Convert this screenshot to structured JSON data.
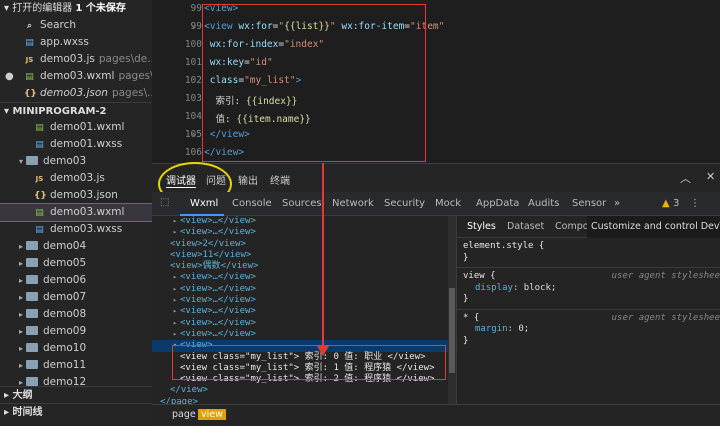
{
  "sidebar": {
    "open_editors_title": "打开的编辑器",
    "unsaved_badge": "1 个未保存",
    "open_editors": [
      {
        "icon": "search-icon",
        "label": "Search",
        "hint": ""
      },
      {
        "icon": "css-file-icon",
        "label": "app.wxss",
        "hint": ""
      },
      {
        "icon": "js-file-icon",
        "label": "demo03.js",
        "hint": "pages\\de..."
      },
      {
        "icon": "xml-file-icon",
        "label": "demo03.wxml",
        "hint": "pages\\..."
      },
      {
        "icon": "json-file-icon",
        "label": "demo03.json",
        "hint": "pages\\..."
      }
    ],
    "project_title": "MINIPROGRAM-2",
    "tree": [
      {
        "icon": "xml-file-icon",
        "label": "demo01.wxml",
        "indent": 2
      },
      {
        "icon": "css-file-icon",
        "label": "demo01.wxss",
        "indent": 2
      },
      {
        "icon": "folder-icon",
        "label": "demo03",
        "indent": 1,
        "arrow": "▾"
      },
      {
        "icon": "js-file-icon",
        "label": "demo03.js",
        "indent": 2
      },
      {
        "icon": "json-file-icon",
        "label": "demo03.json",
        "indent": 2
      },
      {
        "icon": "xml-file-icon",
        "label": "demo03.wxml",
        "indent": 2,
        "selected": true
      },
      {
        "icon": "css-file-icon",
        "label": "demo03.wxss",
        "indent": 2
      },
      {
        "icon": "folder-icon",
        "label": "demo04",
        "indent": 1,
        "arrow": "▸"
      },
      {
        "icon": "folder-icon",
        "label": "demo05",
        "indent": 1,
        "arrow": "▸"
      },
      {
        "icon": "folder-icon",
        "label": "demo06",
        "indent": 1,
        "arrow": "▸"
      },
      {
        "icon": "folder-icon",
        "label": "demo07",
        "indent": 1,
        "arrow": "▸"
      },
      {
        "icon": "folder-icon",
        "label": "demo08",
        "indent": 1,
        "arrow": "▸"
      },
      {
        "icon": "folder-icon",
        "label": "demo09",
        "indent": 1,
        "arrow": "▸"
      },
      {
        "icon": "folder-icon",
        "label": "demo10",
        "indent": 1,
        "arrow": "▸"
      },
      {
        "icon": "folder-icon",
        "label": "demo11",
        "indent": 1,
        "arrow": "▸"
      },
      {
        "icon": "folder-icon",
        "label": "demo12",
        "indent": 1,
        "arrow": "▸"
      }
    ],
    "outline_title": "大纲",
    "timeline_title": "时间线"
  },
  "editor": {
    "lines": [
      {
        "num": "99",
        "html": "<span class='tag'>&lt;view&gt;</span>"
      },
      {
        "num": "99",
        "html": "<span class='tag'>&lt;view</span> <span class='attr'>wx:for</span>=<span class='str'>\"<span class='brace'>{{list}}</span>\"</span> <span class='attr'>wx:for-item</span>=<span class='str'>\"item\"</span>"
      },
      {
        "num": "100",
        "html": "&nbsp;<span class='attr'>wx:for-index</span>=<span class='str'>\"index\"</span>"
      },
      {
        "num": "101",
        "html": "&nbsp;<span class='attr'>wx:key</span>=<span class='str'>\"id\"</span>"
      },
      {
        "num": "102",
        "html": "&nbsp;<span class='attr'>class</span>=<span class='str'>\"my_list\"</span><span class='tag'>&gt;</span>"
      },
      {
        "num": "103",
        "html": "&nbsp;&nbsp;<span class='cn'>索引: </span><span class='brace'>{{index}}</span>"
      },
      {
        "num": "104",
        "html": "&nbsp;&nbsp;<span class='cn'>值: </span><span class='brace'>{{item.name}}</span>"
      },
      {
        "num": "105",
        "html": "&nbsp;<span class='tag'>&lt;/view&gt;</span>"
      },
      {
        "num": "106",
        "html": "<span class='tag'>&lt;/view&gt;</span>"
      }
    ]
  },
  "debugger": {
    "tabs": [
      "调试器",
      "问题",
      "输出",
      "终端"
    ],
    "panel_tabs": [
      "Wxml",
      "Console",
      "Sources",
      "Network",
      "Security",
      "Mock",
      "AppData",
      "Audits",
      "Sensor"
    ],
    "more": "»",
    "warnings": "3",
    "dom_lines": [
      {
        "tri": "▸",
        "text": "<view>…</view>",
        "indent": 0
      },
      {
        "tri": "▸",
        "text": "<view>…</view>",
        "indent": 0
      },
      {
        "tri": "",
        "text": "<view>2</view>",
        "indent": 0
      },
      {
        "tri": "",
        "text": "<view>11</view>",
        "indent": 0
      },
      {
        "tri": "",
        "text": "<view>偶数</view>",
        "indent": 0
      },
      {
        "tri": "▸",
        "text": "<view>…</view>",
        "indent": 0
      },
      {
        "tri": "▸",
        "text": "<view>…</view>",
        "indent": 0
      },
      {
        "tri": "▸",
        "text": "<view>…</view>",
        "indent": 0
      },
      {
        "tri": "▸",
        "text": "<view>…</view>",
        "indent": 0
      },
      {
        "tri": "▸",
        "text": "<view>…</view>",
        "indent": 0
      },
      {
        "tri": "▸",
        "text": "<view>…</view>",
        "indent": 0
      },
      {
        "tri": "▾",
        "text": "<view>",
        "indent": 0,
        "hl": true
      },
      {
        "tri": "",
        "text": "<view  class=\"my_list\"> 索引: 0   值: 职业 </view>",
        "indent": 1
      },
      {
        "tri": "",
        "text": "<view  class=\"my_list\"> 索引: 1   值: 程序猿 </view>",
        "indent": 1
      },
      {
        "tri": "",
        "text": "<view  class=\"my_list\"> 索引: 2   值: 程序猿 </view>",
        "indent": 1
      },
      {
        "tri": "",
        "text": "</view>",
        "indent": 0
      },
      {
        "tri": "",
        "text": "</page>",
        "indent": -1
      }
    ],
    "style_tabs": [
      "Styles",
      "Dataset",
      "Compon"
    ],
    "tooltip": "Customize and control DevTools",
    "style_rules": [
      {
        "selector": "element.style {",
        "src": "",
        "props": [],
        "close": "}"
      },
      {
        "selector": "view {",
        "src": "user agent styleshee",
        "props": [
          {
            "k": "display",
            "v": "block;"
          }
        ],
        "close": "}"
      },
      {
        "selector": "* {",
        "src": "user agent styleshee",
        "props": [
          {
            "k": "margin",
            "v": "0;"
          }
        ],
        "close": "}"
      }
    ],
    "breadcrumbs": [
      "page",
      "view"
    ]
  },
  "colors": {
    "highlight_box": "#e53935",
    "circle": "#e8d800",
    "accent": "#4d90fe"
  }
}
